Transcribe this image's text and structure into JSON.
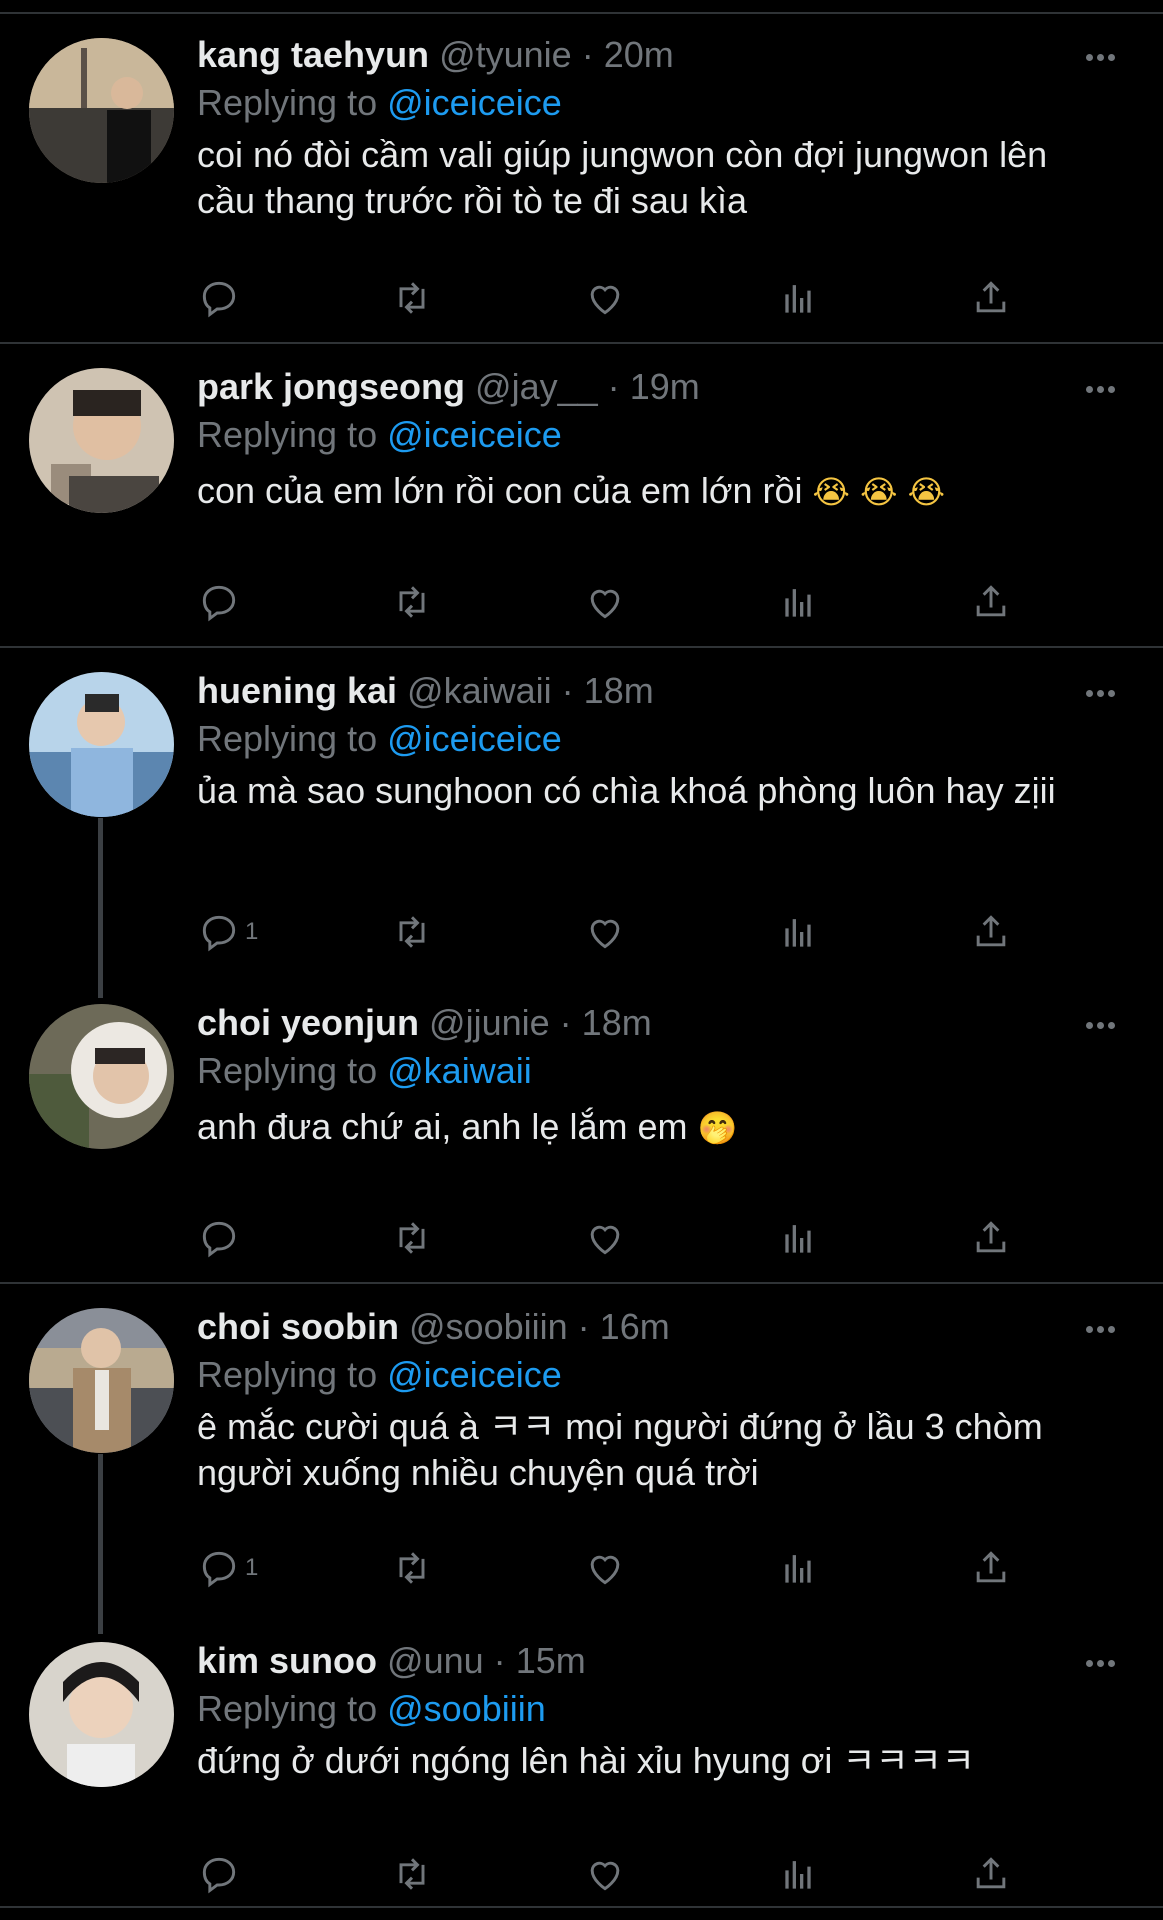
{
  "colors": {
    "background": "#000000",
    "text": "#e7e9ea",
    "muted": "#71767b",
    "mention": "#1d9bf0",
    "divider": "#2f3336"
  },
  "replying_label": "Replying to",
  "tweets": [
    {
      "name": "kang taehyun",
      "handle": "@tyunie",
      "sep": "·",
      "time": "20m",
      "reply_to": "@iceiceice",
      "text": "coi nó đòi cầm vali giúp jungwon còn đợi jungwon lên cầu thang trước rồi tò te đi sau kìa",
      "reply_count": "",
      "avatar_icon": "avatar-photo-paris"
    },
    {
      "name": "park jongseong",
      "handle": "@jay__",
      "sep": "·",
      "time": "19m",
      "reply_to": "@iceiceice",
      "text": "con của em lớn rồi con của em lớn rồi",
      "emoji": "😭 😭 😭",
      "reply_count": "",
      "avatar_icon": "avatar-photo-selfie"
    },
    {
      "name": "huening kai",
      "handle": "@kaiwaii",
      "sep": "·",
      "time": "18m",
      "reply_to": "@iceiceice",
      "text": "ủa mà sao sunghoon có chìa khoá phòng luôn hay zịii",
      "reply_count": "1",
      "avatar_icon": "avatar-photo-sea"
    },
    {
      "name": "choi yeonjun",
      "handle": "@jjunie",
      "sep": "·",
      "time": "18m",
      "reply_to": "@kaiwaii",
      "text": "anh đưa chứ ai, anh lẹ lắm em",
      "emoji": "🤭",
      "reply_count": "",
      "avatar_icon": "avatar-photo-hood"
    },
    {
      "name": "choi soobin",
      "handle": "@soobiiin",
      "sep": "·",
      "time": "16m",
      "reply_to": "@iceiceice",
      "text": "ê mắc cười quá à ㅋㅋ mọi người đứng ở lầu 3 chòm người xuống nhiều chuyện quá trời",
      "reply_count": "1",
      "avatar_icon": "avatar-photo-city"
    },
    {
      "name": "kim sunoo",
      "handle": "@unu",
      "sep": "·",
      "time": "15m",
      "reply_to": "@soobiiin",
      "text": "đứng ở dưới ngóng lên hài xỉu hyung ơi ㅋㅋㅋㅋ",
      "reply_count": "",
      "avatar_icon": "avatar-photo-portrait"
    }
  ]
}
